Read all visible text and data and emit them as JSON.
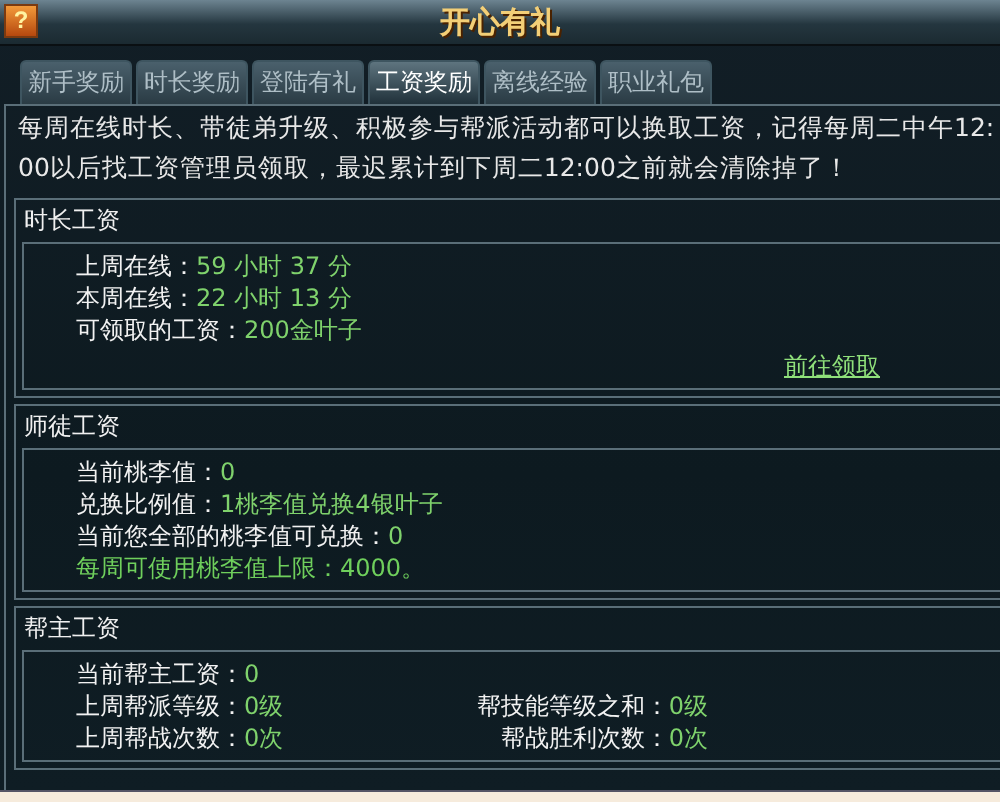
{
  "window": {
    "title": "开心有礼",
    "help_button": "?"
  },
  "tabs": [
    {
      "label": "新手奖励",
      "selected": false
    },
    {
      "label": "时长奖励",
      "selected": false
    },
    {
      "label": "登陆有礼",
      "selected": false
    },
    {
      "label": "工资奖励",
      "selected": true
    },
    {
      "label": "离线经验",
      "selected": false
    },
    {
      "label": "职业礼包",
      "selected": false
    }
  ],
  "intro": "每周在线时长、带徒弟升级、积极参与帮派活动都可以换取工资，记得每周二中午12:00以后找工资管理员领取，最迟累计到下周二12:00之前就会清除掉了！",
  "sections": [
    {
      "title": "时长工资",
      "rows": [
        {
          "kind": "pair",
          "cells": [
            {
              "label": "上周在线：",
              "value": "59 小时 37 分"
            }
          ]
        },
        {
          "kind": "pair",
          "cells": [
            {
              "label": "本周在线：",
              "value": "22 小时 13 分"
            }
          ]
        },
        {
          "kind": "pair",
          "cells": [
            {
              "label": "可领取的工资：",
              "value": "200金叶子"
            }
          ]
        }
      ],
      "link": "前往领取"
    },
    {
      "title": "师徒工资",
      "rows": [
        {
          "kind": "pair",
          "cells": [
            {
              "label": "当前桃李值：",
              "value": "0"
            }
          ]
        },
        {
          "kind": "pair",
          "cells": [
            {
              "label": "兑换比例值：",
              "value": "1桃李值兑换4银叶子"
            }
          ]
        },
        {
          "kind": "pair",
          "cells": [
            {
              "label": "当前您全部的桃李值可兑换：",
              "value": "0"
            }
          ]
        },
        {
          "kind": "note",
          "text": "每周可使用桃李值上限：4000。"
        }
      ]
    },
    {
      "title": "帮主工资",
      "rows": [
        {
          "kind": "pair",
          "cells": [
            {
              "label": "当前帮主工资：",
              "value": "0"
            }
          ]
        },
        {
          "kind": "pair",
          "cells": [
            {
              "label": "上周帮派等级：",
              "value": "0级"
            },
            {
              "label": "帮技能等级之和：",
              "value": "0级"
            }
          ]
        },
        {
          "kind": "pair",
          "cells": [
            {
              "label": "上周帮战次数：",
              "value": "0次"
            },
            {
              "label": "帮战胜利次数：",
              "value": "0次"
            }
          ]
        }
      ]
    }
  ]
}
